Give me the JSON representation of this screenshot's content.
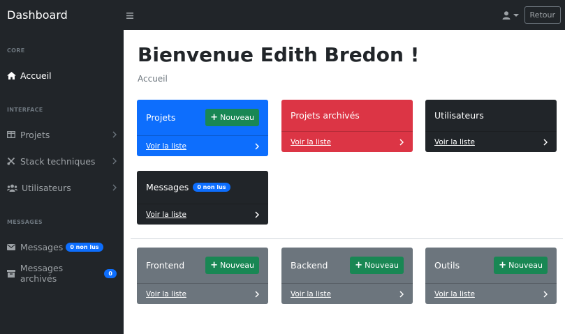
{
  "navbar": {
    "brand": "Dashboard",
    "toggle_icon": "menu-icon",
    "user_icon": "user-icon",
    "retour_label": "Retour"
  },
  "sidebar": {
    "sections": {
      "core": "CORE",
      "interface": "INTERFACE",
      "messages": "MESSAGES"
    },
    "items": {
      "accueil": "Accueil",
      "projets": "Projets",
      "stack": "Stack techniques",
      "utilisateurs": "Utilisateurs",
      "messages": "Messages",
      "messages_badge": "0 non lus",
      "archived": "Messages archivés",
      "archived_badge": "0"
    }
  },
  "main": {
    "title": "Bienvenue Edith Bredon !",
    "breadcrumb": "Accueil",
    "nouveau_label": "Nouveau",
    "voir_liste": "Voir la liste",
    "cards": {
      "projets": "Projets",
      "projets_archives": "Projets archivés",
      "utilisateurs": "Utilisateurs",
      "messages": "Messages",
      "messages_badge": "0 non lus",
      "frontend": "Frontend",
      "backend": "Backend",
      "outils": "Outils"
    }
  },
  "colors": {
    "primary": "#0d6efd",
    "danger": "#dc3545",
    "dark": "#212529",
    "secondary": "#6c757d",
    "success": "#198754"
  }
}
